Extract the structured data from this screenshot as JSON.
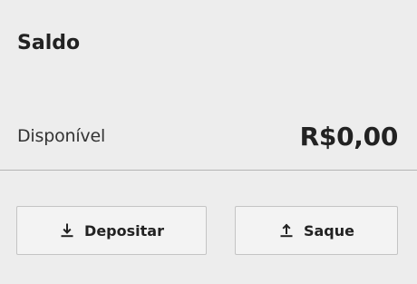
{
  "card": {
    "title": "Saldo",
    "balance_label": "Disponível",
    "balance_value": "R$0,00"
  },
  "actions": {
    "deposit_label": "Depositar",
    "deposit_icon": "download-icon",
    "withdraw_label": "Saque",
    "withdraw_icon": "upload-icon"
  },
  "colors": {
    "background": "#ededed",
    "text": "#222222",
    "button_bg": "#f3f3f3",
    "button_border": "#c4c4c4",
    "divider": "#b5b5b5"
  }
}
